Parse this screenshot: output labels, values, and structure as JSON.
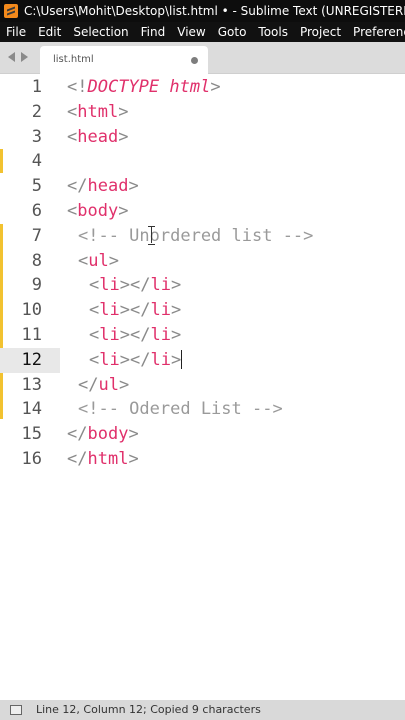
{
  "window": {
    "title": "C:\\Users\\Mohit\\Desktop\\list.html • - Sublime Text (UNREGISTERED)"
  },
  "menu": [
    "File",
    "Edit",
    "Selection",
    "Find",
    "View",
    "Goto",
    "Tools",
    "Project",
    "Preferences"
  ],
  "tab": {
    "label": "list.html"
  },
  "editor": {
    "line_numbers": [
      "1",
      "2",
      "3",
      "4",
      "5",
      "6",
      "7",
      "8",
      "9",
      "10",
      "11",
      "12",
      "13",
      "14",
      "15",
      "16"
    ],
    "active_line": "12",
    "lines": {
      "l1": {
        "lt": "<!",
        "doctype": "DOCTYPE",
        "sp": " ",
        "html": "html",
        "gt": ">"
      },
      "l2": {
        "lt": "<",
        "tag": "html",
        "gt": ">"
      },
      "l3": {
        "lt": "<",
        "tag": "head",
        "gt": ">"
      },
      "l5": {
        "lt": "</",
        "tag": "head",
        "gt": ">"
      },
      "l6": {
        "lt": "<",
        "tag": "body",
        "gt": ">"
      },
      "l7": {
        "text": "<!-- Unordered list -->"
      },
      "l8": {
        "lt": "<",
        "tag": "ul",
        "gt": ">"
      },
      "li": {
        "lt": "<",
        "tag": "li",
        "mid": "></",
        "tag2": "li",
        "gt": ">"
      },
      "l13": {
        "lt": "</",
        "tag": "ul",
        "gt": ">"
      },
      "l14": {
        "text": "<!-- Odered List -->"
      },
      "l15": {
        "lt": "</",
        "tag": "body",
        "gt": ">"
      },
      "l16": {
        "lt": "</",
        "tag": "html",
        "gt": ">"
      }
    }
  },
  "status": {
    "text": "Line 12, Column 12; Copied 9 characters"
  },
  "colors": {
    "tag": "#e0306b",
    "modified_marker": "#f2c230",
    "titlebar": "#0d0d0d"
  }
}
